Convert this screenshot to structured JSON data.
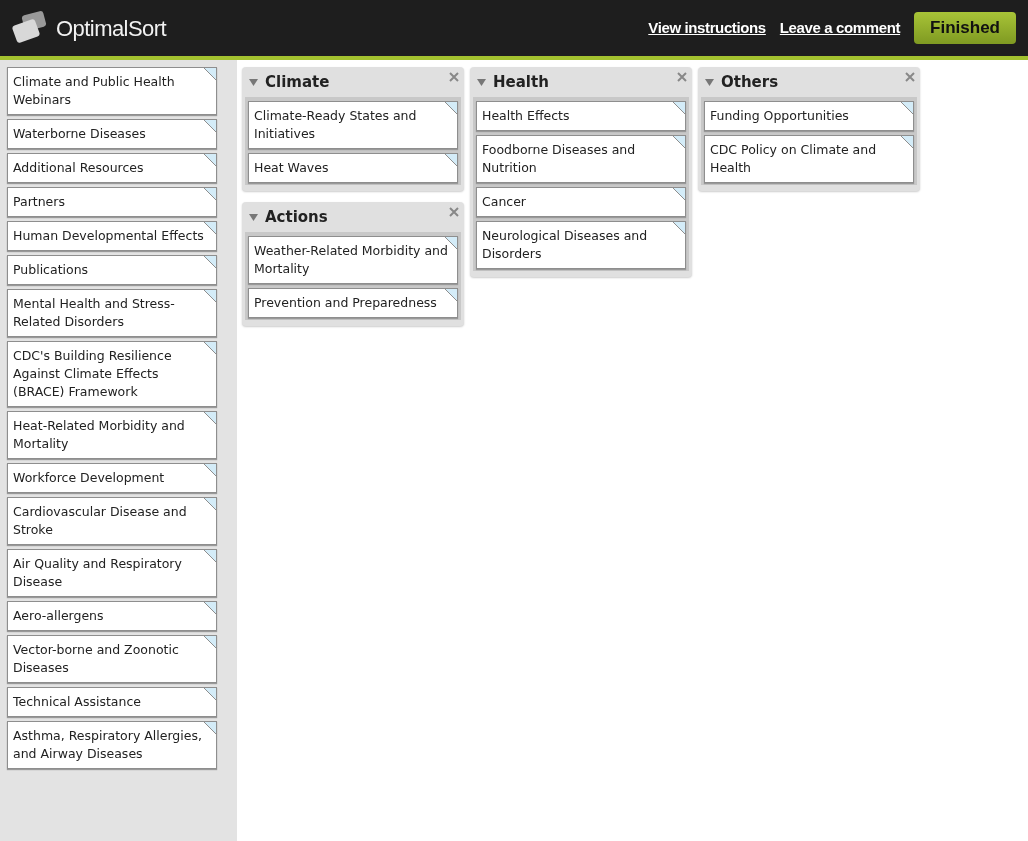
{
  "header": {
    "logo": "OptimalSort",
    "links": [
      "View instructions",
      "Leave a comment"
    ],
    "finish_button": "Finished"
  },
  "unsorted_cards": [
    "Climate and Public Health Webinars",
    "Waterborne Diseases",
    "Additional Resources",
    "Partners",
    "Human Developmental Effects",
    "Publications",
    "Mental Health and Stress-Related Disorders",
    "CDC's Building Resilience Against Climate Effects (BRACE) Framework",
    "Heat-Related Morbidity and Mortality",
    "Workforce Development",
    "Cardiovascular Disease and Stroke",
    "Air Quality and Respiratory Disease",
    "Aero-allergens",
    "Vector-borne and Zoonotic Diseases",
    "Technical Assistance",
    "Asthma, Respiratory Allergies, and Airway Diseases"
  ],
  "group_columns": [
    [
      {
        "title": "Climate",
        "expanded": true,
        "cards": [
          "Climate-Ready States and Initiatives",
          "Heat Waves"
        ]
      },
      {
        "title": "Actions",
        "expanded": true,
        "cards": [
          "Weather-Related Morbidity and Mortality",
          "Prevention and Preparedness"
        ]
      }
    ],
    [
      {
        "title": "Health",
        "expanded": true,
        "cards": [
          "Health Effects",
          "Foodborne Diseases and Nutrition",
          "Cancer",
          "Neurological Diseases and Disorders"
        ]
      }
    ],
    [
      {
        "title": "Others",
        "expanded": true,
        "cards": [
          "Funding Opportunities",
          "CDC Policy on Climate and Health"
        ]
      }
    ]
  ]
}
